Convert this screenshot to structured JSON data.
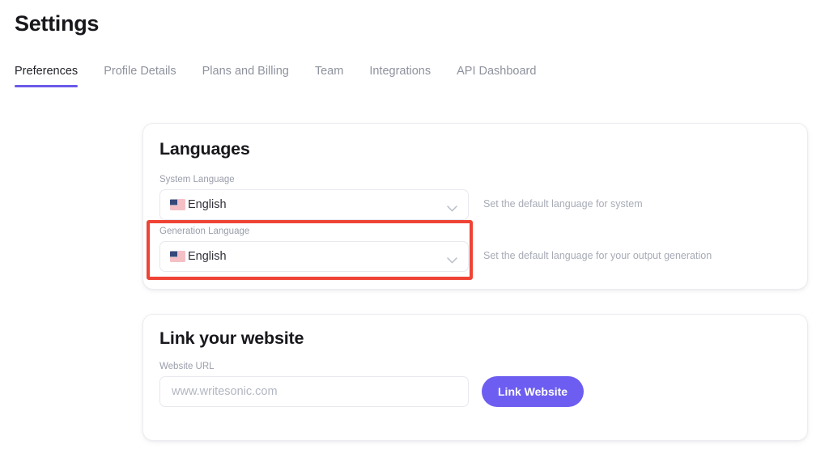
{
  "header": {
    "title": "Settings"
  },
  "tabs": [
    {
      "label": "Preferences",
      "active": true
    },
    {
      "label": "Profile Details",
      "active": false
    },
    {
      "label": "Plans and Billing",
      "active": false
    },
    {
      "label": "Team",
      "active": false
    },
    {
      "label": "Integrations",
      "active": false
    },
    {
      "label": "API Dashboard",
      "active": false
    }
  ],
  "languages_card": {
    "title": "Languages",
    "system_language": {
      "label": "System Language",
      "value": "English",
      "flag_icon": "us-flag-icon",
      "chevron_icon": "chevron-down-icon",
      "help": "Set the default language for system"
    },
    "generation_language": {
      "label": "Generation Language",
      "value": "English",
      "flag_icon": "us-flag-icon",
      "chevron_icon": "chevron-down-icon",
      "help": "Set the default language for your output generation",
      "highlighted": true
    }
  },
  "website_card": {
    "title": "Link your website",
    "url_field": {
      "label": "Website URL",
      "value": "",
      "placeholder": "www.writesonic.com"
    },
    "submit_button": {
      "label": "Link Website"
    }
  },
  "colors": {
    "accent_purple": "#6d5df0",
    "highlight_red": "#ef4335",
    "page_background": "#ffffff",
    "card_background": "#ffffff",
    "card_border": "#ededf1",
    "muted_text": "#9a9eaa",
    "title_text": "#17171c"
  }
}
